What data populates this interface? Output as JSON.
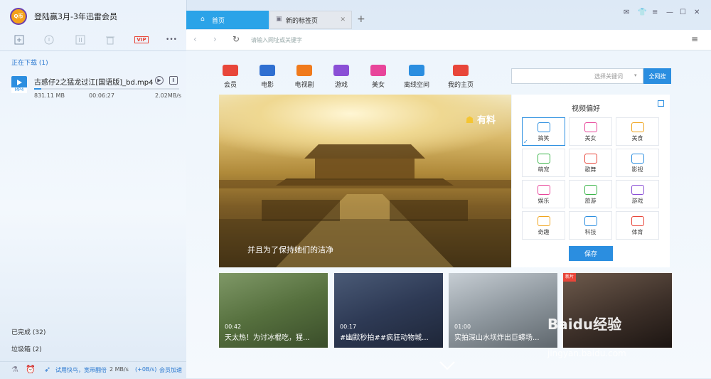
{
  "left_panel": {
    "avatar_text": "Q币",
    "user_title": "登陆赢3月-3年迅雷会员",
    "toolbar": {
      "new_icon": "plus-icon",
      "download_icon": "download-icon",
      "pause_icon": "pause-icon",
      "delete_icon": "trash-icon",
      "vip_label": "VIP",
      "more_label": "•••"
    },
    "downloading_header": "正在下载 (1)",
    "task": {
      "file_ext": "MP4",
      "file_name": "古惑仔2之猛龙过江[国语版]_bd.mp4",
      "size": "831.11 MB",
      "time": "00:06:27",
      "speed": "2.02MB/s",
      "progress": 0.05
    },
    "completed_label": "已完成 (32)",
    "trash_label": "垃圾箱 (2)",
    "footer": {
      "trial_text": "试用快鸟，宽带翻倍",
      "speed_text": "2 MB/s",
      "plus_text": "(+0B/s)",
      "vip_accel": "会员加速"
    }
  },
  "browser": {
    "tabs": [
      {
        "label": "首页",
        "active": true
      },
      {
        "label": "新的标签页",
        "active": false
      }
    ],
    "new_tab_label": "+",
    "window_icons": [
      "mail-icon",
      "shirt-icon",
      "menu-icon",
      "minimize-icon",
      "maximize-icon",
      "close-icon"
    ],
    "address_placeholder": "请输入网址或关键字",
    "categories": [
      {
        "label": "会员",
        "icon": "vip-icon",
        "color": "#e8463a"
      },
      {
        "label": "电影",
        "icon": "film-icon",
        "color": "#2f6fd1"
      },
      {
        "label": "电视剧",
        "icon": "tv-icon",
        "color": "#f07a1c"
      },
      {
        "label": "游戏",
        "icon": "gamepad-icon",
        "color": "#8a4fd6"
      },
      {
        "label": "美女",
        "icon": "mask-icon",
        "color": "#e8459a"
      },
      {
        "label": "离线空间",
        "icon": "cloud-icon",
        "color": "#2b8ee0"
      },
      {
        "label": "我的主页",
        "icon": "profile-icon",
        "color": "#e8463a"
      }
    ],
    "search": {
      "keyword_placeholder": "选择关键词",
      "button_label": "全网搜"
    },
    "video": {
      "caption": "并且为了保持她们的洁净",
      "logo_text": "有料"
    },
    "preferences": {
      "title": "视频偏好",
      "items": [
        {
          "label": "搞笑",
          "color": "#2b8ee0",
          "selected": true
        },
        {
          "label": "美女",
          "color": "#e8459a",
          "selected": false
        },
        {
          "label": "美食",
          "color": "#f0a41c",
          "selected": false
        },
        {
          "label": "萌宠",
          "color": "#3bb54a",
          "selected": false
        },
        {
          "label": "歌舞",
          "color": "#e8463a",
          "selected": false
        },
        {
          "label": "影视",
          "color": "#2b8ee0",
          "selected": false
        },
        {
          "label": "娱乐",
          "color": "#e8459a",
          "selected": false
        },
        {
          "label": "旅游",
          "color": "#3bb54a",
          "selected": false
        },
        {
          "label": "游戏",
          "color": "#8a4fd6",
          "selected": false
        },
        {
          "label": "奇趣",
          "color": "#f0a41c",
          "selected": false
        },
        {
          "label": "科技",
          "color": "#2b8ee0",
          "selected": false
        },
        {
          "label": "体育",
          "color": "#e8463a",
          "selected": false
        }
      ],
      "save_label": "保存"
    },
    "thumbnails": [
      {
        "duration": "00:42",
        "title": "天太热！为讨冰棍吃，猩...",
        "badge": ""
      },
      {
        "duration": "00:17",
        "title": "#幽默秒拍##疯狂动物城...",
        "badge": ""
      },
      {
        "duration": "01:00",
        "title": "实拍深山水坝炸出巨蟒场...",
        "badge": ""
      },
      {
        "duration": "",
        "title": "",
        "badge": "新片"
      }
    ]
  },
  "watermark": {
    "main": "Baidu经验",
    "sub": "jingyan.baidu.com"
  }
}
